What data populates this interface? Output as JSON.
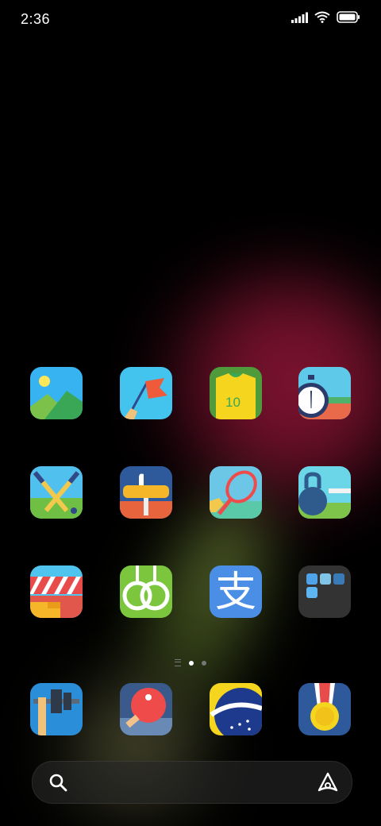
{
  "status_bar": {
    "time": "2:36",
    "signal_icon": "signal-bars-icon",
    "wifi_icon": "wifi-icon",
    "battery_icon": "battery-full-icon"
  },
  "home_grid": [
    {
      "icon": "gallery-icon"
    },
    {
      "icon": "flag-icon"
    },
    {
      "icon": "jersey-icon",
      "jersey_number": "10"
    },
    {
      "icon": "stopwatch-icon"
    },
    {
      "icon": "cricket-icon"
    },
    {
      "icon": "pommel-horse-icon"
    },
    {
      "icon": "tennis-icon"
    },
    {
      "icon": "kettlebell-icon"
    },
    {
      "icon": "shop-icon"
    },
    {
      "icon": "rings-icon"
    },
    {
      "icon": "alipay-icon",
      "glyph": "支"
    },
    {
      "icon": "folder-icon"
    }
  ],
  "pager": {
    "pages": 2,
    "current": 1
  },
  "dock": [
    {
      "icon": "weightlifting-icon"
    },
    {
      "icon": "table-tennis-icon"
    },
    {
      "icon": "brazil-flag-icon"
    },
    {
      "icon": "medal-icon"
    }
  ],
  "search_bar": {
    "search_icon": "search-icon",
    "assistant_icon": "assistant-icon"
  }
}
